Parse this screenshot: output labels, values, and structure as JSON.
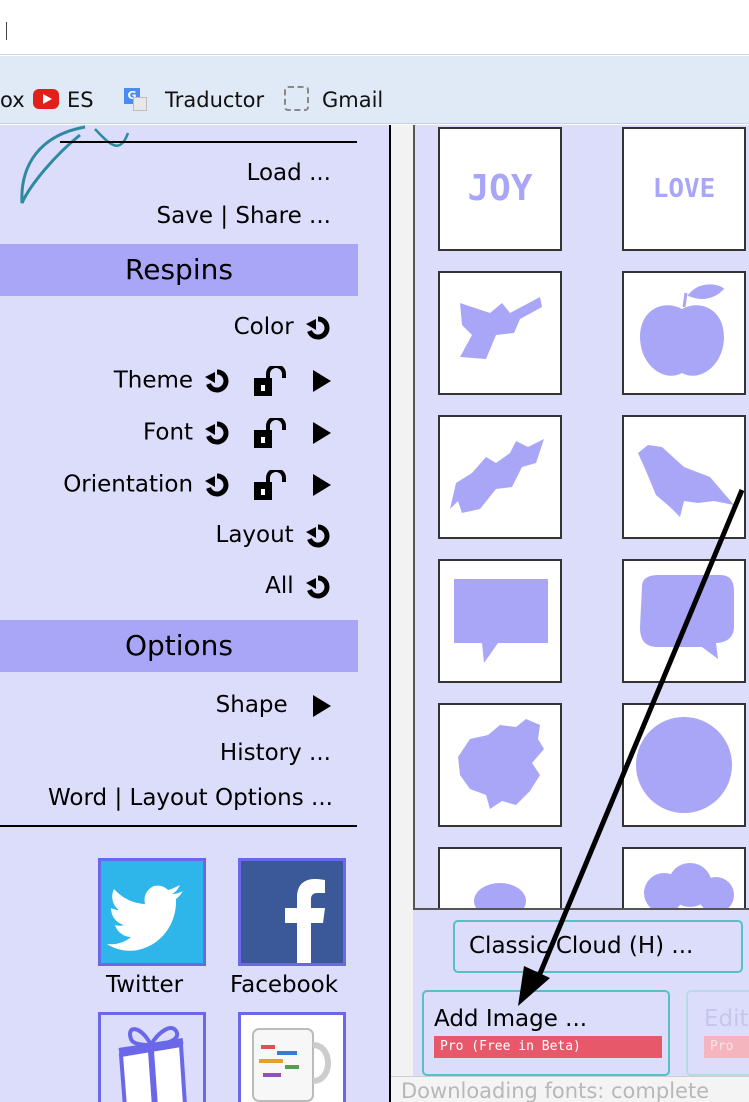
{
  "bookmarks": [
    {
      "label": "ox",
      "icon": "partial-bookmark"
    },
    {
      "label": "ES",
      "icon": "youtube-icon"
    },
    {
      "label": "Traductor",
      "icon": "google-translate-icon"
    },
    {
      "label": "Gmail",
      "icon": "dashed-placeholder-icon"
    }
  ],
  "menu": {
    "load": "Load ...",
    "save_share": "Save | Share ...",
    "respins_title": "Respins",
    "respins": {
      "color": "Color",
      "theme": "Theme",
      "font": "Font",
      "orientation": "Orientation",
      "layout": "Layout",
      "all": "All"
    },
    "options_title": "Options",
    "options": {
      "shape": "Shape",
      "history": "History ...",
      "word_layout": "Word | Layout Options ..."
    }
  },
  "share": {
    "twitter": "Twitter",
    "facebook": "Facebook"
  },
  "shapes": {
    "joy": "JOY",
    "love": "LOVE"
  },
  "buttons": {
    "classic_cloud": "Classic Cloud (H) ...",
    "add_image": "Add Image ...",
    "pro_badge": "Pro (Free in Beta)",
    "edit": "Edit",
    "edit_pro": "Pro"
  },
  "status": "Downloading fonts: complete",
  "colors": {
    "panel": "#dcdcfb",
    "section": "#a9a6f7",
    "shape": "#a9a6f7",
    "accent_border": "#58c0c5",
    "pro_badge": "#e8586b"
  }
}
